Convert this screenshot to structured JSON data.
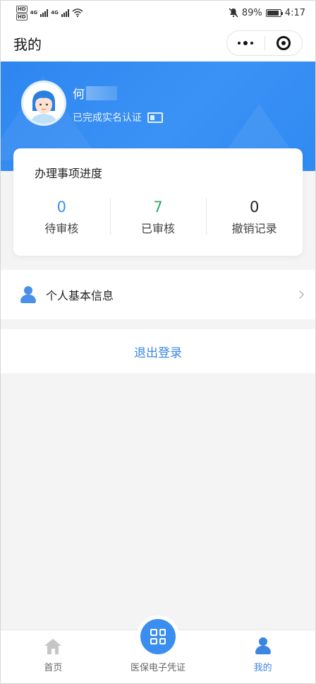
{
  "status_bar": {
    "hd1": "HD",
    "hd2": "HD",
    "net1": "4G",
    "net2": "4G",
    "battery": "89%",
    "time": "4:17",
    "battery_level": 0.89,
    "icons": [
      "signal-icon",
      "wifi-icon",
      "mute-icon",
      "battery-icon"
    ]
  },
  "nav": {
    "title": "我的",
    "more_icon": "more-dots-icon",
    "close_icon": "target-icon"
  },
  "profile": {
    "name": "何",
    "verified_text": "已完成实名认证",
    "verified_icon": "id-card-icon"
  },
  "progress": {
    "title": "办理事项进度",
    "stats": [
      {
        "value": "0",
        "label": "待审核",
        "color": "#3a8ef0"
      },
      {
        "value": "7",
        "label": "已审核",
        "color": "#2fa86a"
      },
      {
        "value": "0",
        "label": "撤销记录",
        "color": "#222222"
      }
    ]
  },
  "menu": {
    "personal_info": "个人基本信息"
  },
  "logout_label": "退出登录",
  "tabbar": {
    "tabs": [
      {
        "label": "首页",
        "icon": "home-icon",
        "active": false
      },
      {
        "label": "医保电子凭证",
        "icon": "qr-code-icon",
        "active": false
      },
      {
        "label": "我的",
        "icon": "user-icon",
        "active": true
      }
    ]
  },
  "colors": {
    "primary": "#3a86e0",
    "header_blue": "#2d86f0",
    "approved_green": "#2fa86a"
  }
}
